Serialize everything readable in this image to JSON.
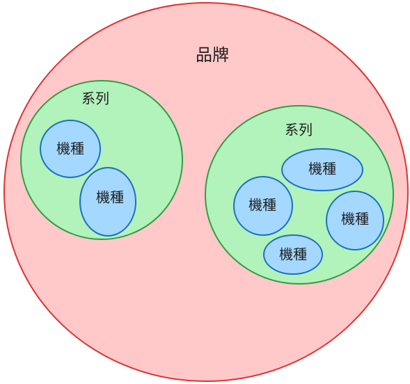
{
  "diagram": {
    "brand": {
      "label": "品牌",
      "fill": "#ffc9c9",
      "stroke": "#e03131"
    },
    "series": [
      {
        "label": "系列",
        "fill": "#b2f2bb",
        "stroke": "#2f9e44",
        "models": [
          {
            "label": "機種"
          },
          {
            "label": "機種"
          }
        ]
      },
      {
        "label": "系列",
        "fill": "#b2f2bb",
        "stroke": "#2f9e44",
        "models": [
          {
            "label": "機種"
          },
          {
            "label": "機種"
          },
          {
            "label": "機種"
          },
          {
            "label": "機種"
          }
        ]
      }
    ],
    "model_fill": "#a5d8ff",
    "model_stroke": "#1971c2"
  }
}
